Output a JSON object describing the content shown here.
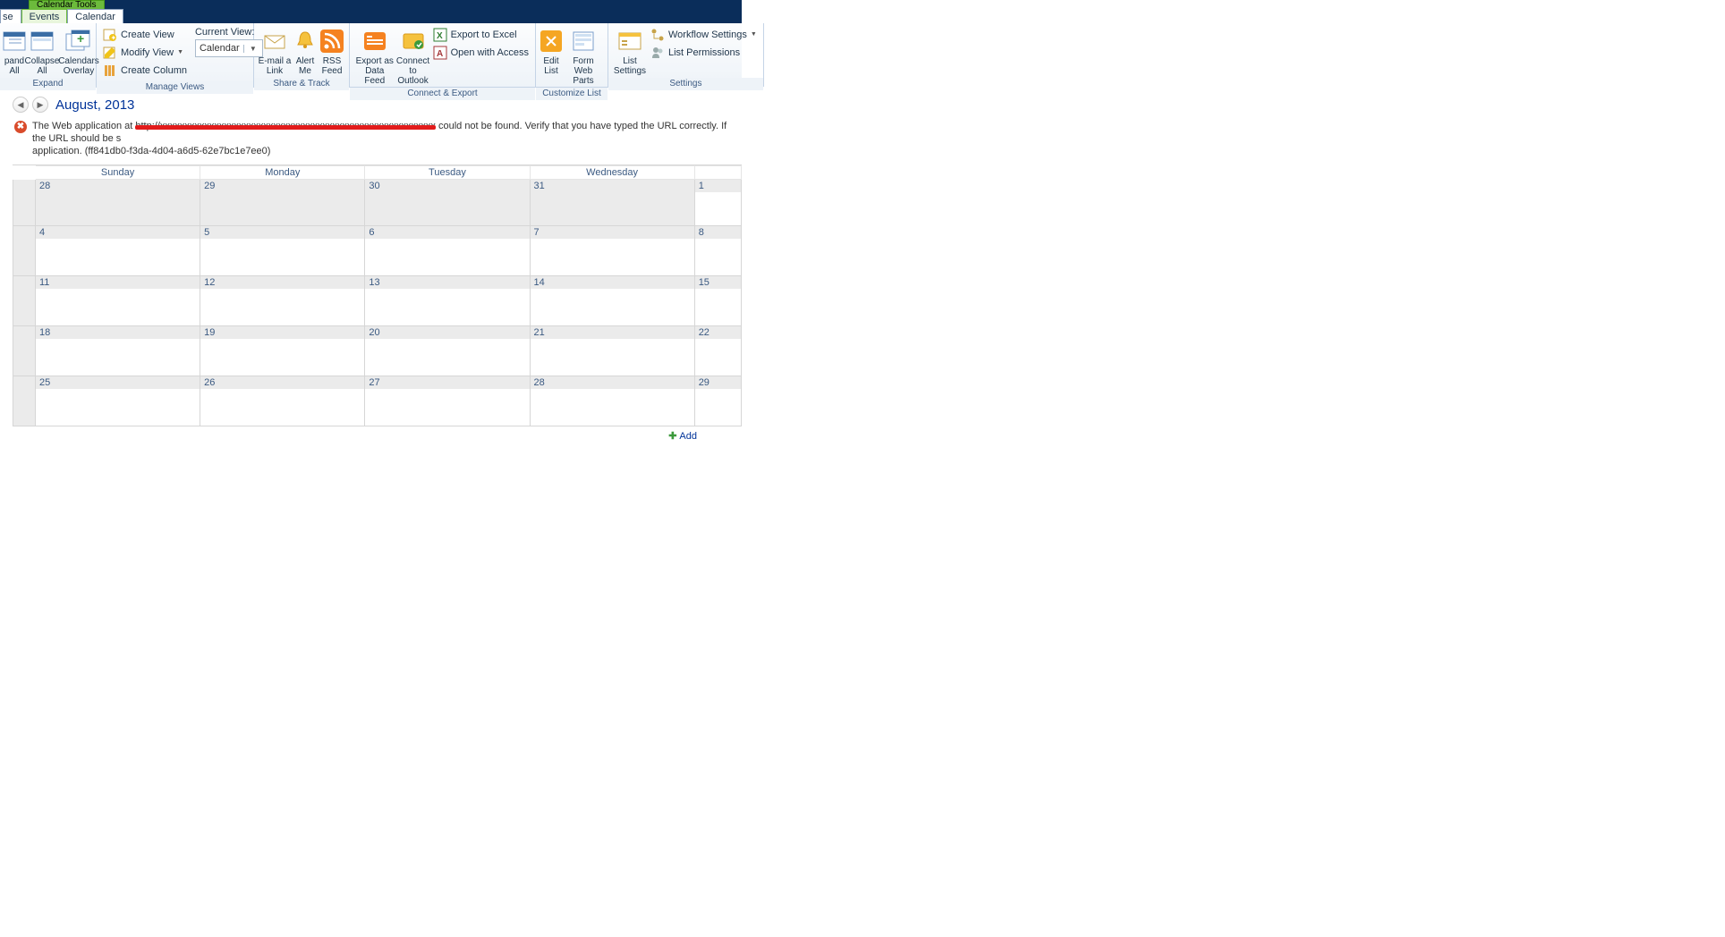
{
  "toolContext": "Calendar Tools",
  "tabs": {
    "browse": "se",
    "events": "Events",
    "calendar": "Calendar"
  },
  "ribbon": {
    "expand": {
      "expand": "pand\nAll",
      "collapse": "Collapse\nAll",
      "overlay": "Calendars\nOverlay",
      "label": "Expand"
    },
    "views": {
      "create": "Create View",
      "modify": "Modify View",
      "column": "Create Column",
      "currentViewLabel": "Current View:",
      "currentView": "Calendar",
      "label": "Manage Views"
    },
    "share": {
      "email": "E-mail a\nLink",
      "alert": "Alert\nMe",
      "rss": "RSS\nFeed",
      "label": "Share & Track"
    },
    "connect": {
      "export": "Export as Data\nFeed",
      "outlook": "Connect to\nOutlook",
      "excel": "Export to Excel",
      "access": "Open with Access",
      "label": "Connect & Export"
    },
    "customize": {
      "edit": "Edit\nList",
      "form": "Form Web\nParts",
      "settings": "List\nSettings",
      "label": "Customize List"
    },
    "settings": {
      "workflow": "Workflow Settings",
      "perms": "List Permissions",
      "label": "Settings"
    }
  },
  "header": {
    "month": "August, 2013"
  },
  "error": {
    "pre": "The Web application at ",
    "redacted": "http://xxxxxxxxxxxxxxxxxxxxxxxxxxxxxxxxxxxxxxxxxxxxxxxxxxxxxxxx",
    "post": " could not be found. Verify that you have typed the URL correctly. If the URL should be s",
    "line2": "application. (ff841db0-f3da-4d04-a6d5-62e7bc1e7ee0)"
  },
  "days": [
    "Sunday",
    "Monday",
    "Tuesday",
    "Wednesday",
    ""
  ],
  "weeks": [
    [
      {
        "n": "28",
        "o": true
      },
      {
        "n": "29",
        "o": true
      },
      {
        "n": "30",
        "o": true
      },
      {
        "n": "31",
        "o": true
      },
      {
        "n": "1",
        "o": false
      }
    ],
    [
      {
        "n": "4",
        "o": false
      },
      {
        "n": "5",
        "o": false
      },
      {
        "n": "6",
        "o": false
      },
      {
        "n": "7",
        "o": false
      },
      {
        "n": "8",
        "o": false
      }
    ],
    [
      {
        "n": "11",
        "o": false
      },
      {
        "n": "12",
        "o": false
      },
      {
        "n": "13",
        "o": false
      },
      {
        "n": "14",
        "o": false
      },
      {
        "n": "15",
        "o": false
      }
    ],
    [
      {
        "n": "18",
        "o": false
      },
      {
        "n": "19",
        "o": false
      },
      {
        "n": "20",
        "o": false
      },
      {
        "n": "21",
        "o": false
      },
      {
        "n": "22",
        "o": false
      }
    ],
    [
      {
        "n": "25",
        "o": false
      },
      {
        "n": "26",
        "o": false
      },
      {
        "n": "27",
        "o": false
      },
      {
        "n": "28",
        "o": false
      },
      {
        "n": "29",
        "o": false
      }
    ]
  ],
  "add": "Add"
}
